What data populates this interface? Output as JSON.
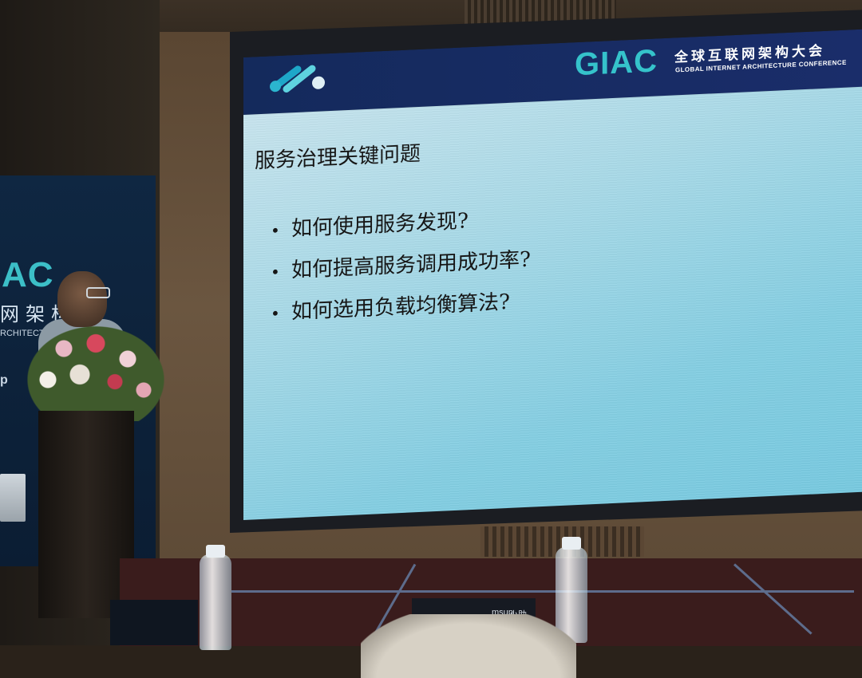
{
  "slide": {
    "header": {
      "logo_text": "GIAC",
      "conference_cn": "全球互联网架构大会",
      "conference_en": "GLOBAL INTERNET ARCHITECTURE CONFERENCE"
    },
    "title": "服务治理关键问题",
    "bullets": [
      "如何使用服务发现?",
      "如何提高服务调用成功率?",
      "如何选用负载均衡算法?"
    ]
  },
  "side_banner": {
    "logo_text": "AC",
    "text_cn": "网架构",
    "text_en": "RCHITECTURE",
    "fragment": "p"
  },
  "stage_sign": {
    "left": "msup",
    "right": "小助"
  },
  "colors": {
    "screen_header": "#142a5c",
    "logo_teal": "#35c3cb",
    "screen_body": "#a9dbe9"
  }
}
